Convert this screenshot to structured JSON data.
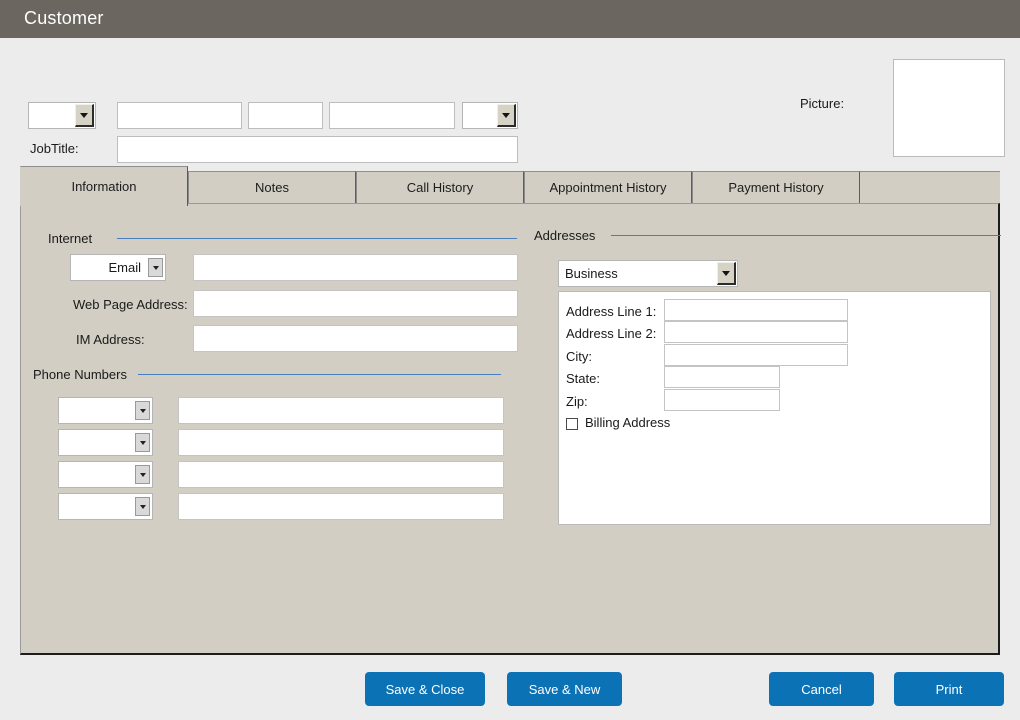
{
  "window": {
    "title": "Customer"
  },
  "header": {
    "name_prefix_value": "",
    "first_name_value": "",
    "middle_name_value": "",
    "last_name_value": "",
    "name_suffix_value": "",
    "jobtitle_label": "JobTitle:",
    "jobtitle_value": "",
    "picture_label": "Picture:"
  },
  "tabs": [
    {
      "label": "Information",
      "active": true
    },
    {
      "label": "Notes",
      "active": false
    },
    {
      "label": "Call History",
      "active": false
    },
    {
      "label": "Appointment History",
      "active": false
    },
    {
      "label": "Payment History",
      "active": false
    }
  ],
  "information": {
    "internet": {
      "group_label": "Internet",
      "type_value": "Email",
      "email_value": "",
      "webpage_label": "Web Page Address:",
      "webpage_value": "",
      "im_label": "IM Address:",
      "im_value": ""
    },
    "phone_numbers": {
      "group_label": "Phone Numbers",
      "rows": [
        {
          "type_value": "",
          "number_value": ""
        },
        {
          "type_value": "",
          "number_value": ""
        },
        {
          "type_value": "",
          "number_value": ""
        },
        {
          "type_value": "",
          "number_value": ""
        }
      ]
    },
    "addresses": {
      "group_label": "Addresses",
      "address_type_value": "Business",
      "line1_label": "Address Line 1:",
      "line1_value": "",
      "line2_label": "Address Line 2:",
      "line2_value": "",
      "city_label": "City:",
      "city_value": "",
      "state_label": "State:",
      "state_value": "",
      "zip_label": "Zip:",
      "zip_value": "",
      "billing_label": "Billing Address",
      "billing_checked": false
    }
  },
  "footer": {
    "save_close_label": "Save & Close",
    "save_new_label": "Save & New",
    "cancel_label": "Cancel",
    "print_label": "Print"
  },
  "colors": {
    "titlebar": "#6b665f",
    "page_bg": "#ececec",
    "panel_bg": "#d2cec3",
    "rule": "#4a7ebb",
    "button_blue": "#0b72b5"
  }
}
